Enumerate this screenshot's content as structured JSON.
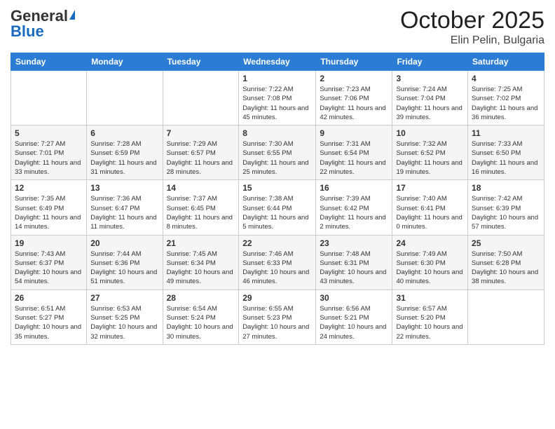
{
  "header": {
    "logo_general": "General",
    "logo_blue": "Blue",
    "month_title": "October 2025",
    "subtitle": "Elin Pelin, Bulgaria"
  },
  "weekdays": [
    "Sunday",
    "Monday",
    "Tuesday",
    "Wednesday",
    "Thursday",
    "Friday",
    "Saturday"
  ],
  "weeks": [
    [
      {
        "day": "",
        "info": ""
      },
      {
        "day": "",
        "info": ""
      },
      {
        "day": "",
        "info": ""
      },
      {
        "day": "1",
        "info": "Sunrise: 7:22 AM\nSunset: 7:08 PM\nDaylight: 11 hours and 45 minutes."
      },
      {
        "day": "2",
        "info": "Sunrise: 7:23 AM\nSunset: 7:06 PM\nDaylight: 11 hours and 42 minutes."
      },
      {
        "day": "3",
        "info": "Sunrise: 7:24 AM\nSunset: 7:04 PM\nDaylight: 11 hours and 39 minutes."
      },
      {
        "day": "4",
        "info": "Sunrise: 7:25 AM\nSunset: 7:02 PM\nDaylight: 11 hours and 36 minutes."
      }
    ],
    [
      {
        "day": "5",
        "info": "Sunrise: 7:27 AM\nSunset: 7:01 PM\nDaylight: 11 hours and 33 minutes."
      },
      {
        "day": "6",
        "info": "Sunrise: 7:28 AM\nSunset: 6:59 PM\nDaylight: 11 hours and 31 minutes."
      },
      {
        "day": "7",
        "info": "Sunrise: 7:29 AM\nSunset: 6:57 PM\nDaylight: 11 hours and 28 minutes."
      },
      {
        "day": "8",
        "info": "Sunrise: 7:30 AM\nSunset: 6:55 PM\nDaylight: 11 hours and 25 minutes."
      },
      {
        "day": "9",
        "info": "Sunrise: 7:31 AM\nSunset: 6:54 PM\nDaylight: 11 hours and 22 minutes."
      },
      {
        "day": "10",
        "info": "Sunrise: 7:32 AM\nSunset: 6:52 PM\nDaylight: 11 hours and 19 minutes."
      },
      {
        "day": "11",
        "info": "Sunrise: 7:33 AM\nSunset: 6:50 PM\nDaylight: 11 hours and 16 minutes."
      }
    ],
    [
      {
        "day": "12",
        "info": "Sunrise: 7:35 AM\nSunset: 6:49 PM\nDaylight: 11 hours and 14 minutes."
      },
      {
        "day": "13",
        "info": "Sunrise: 7:36 AM\nSunset: 6:47 PM\nDaylight: 11 hours and 11 minutes."
      },
      {
        "day": "14",
        "info": "Sunrise: 7:37 AM\nSunset: 6:45 PM\nDaylight: 11 hours and 8 minutes."
      },
      {
        "day": "15",
        "info": "Sunrise: 7:38 AM\nSunset: 6:44 PM\nDaylight: 11 hours and 5 minutes."
      },
      {
        "day": "16",
        "info": "Sunrise: 7:39 AM\nSunset: 6:42 PM\nDaylight: 11 hours and 2 minutes."
      },
      {
        "day": "17",
        "info": "Sunrise: 7:40 AM\nSunset: 6:41 PM\nDaylight: 11 hours and 0 minutes."
      },
      {
        "day": "18",
        "info": "Sunrise: 7:42 AM\nSunset: 6:39 PM\nDaylight: 10 hours and 57 minutes."
      }
    ],
    [
      {
        "day": "19",
        "info": "Sunrise: 7:43 AM\nSunset: 6:37 PM\nDaylight: 10 hours and 54 minutes."
      },
      {
        "day": "20",
        "info": "Sunrise: 7:44 AM\nSunset: 6:36 PM\nDaylight: 10 hours and 51 minutes."
      },
      {
        "day": "21",
        "info": "Sunrise: 7:45 AM\nSunset: 6:34 PM\nDaylight: 10 hours and 49 minutes."
      },
      {
        "day": "22",
        "info": "Sunrise: 7:46 AM\nSunset: 6:33 PM\nDaylight: 10 hours and 46 minutes."
      },
      {
        "day": "23",
        "info": "Sunrise: 7:48 AM\nSunset: 6:31 PM\nDaylight: 10 hours and 43 minutes."
      },
      {
        "day": "24",
        "info": "Sunrise: 7:49 AM\nSunset: 6:30 PM\nDaylight: 10 hours and 40 minutes."
      },
      {
        "day": "25",
        "info": "Sunrise: 7:50 AM\nSunset: 6:28 PM\nDaylight: 10 hours and 38 minutes."
      }
    ],
    [
      {
        "day": "26",
        "info": "Sunrise: 6:51 AM\nSunset: 5:27 PM\nDaylight: 10 hours and 35 minutes."
      },
      {
        "day": "27",
        "info": "Sunrise: 6:53 AM\nSunset: 5:25 PM\nDaylight: 10 hours and 32 minutes."
      },
      {
        "day": "28",
        "info": "Sunrise: 6:54 AM\nSunset: 5:24 PM\nDaylight: 10 hours and 30 minutes."
      },
      {
        "day": "29",
        "info": "Sunrise: 6:55 AM\nSunset: 5:23 PM\nDaylight: 10 hours and 27 minutes."
      },
      {
        "day": "30",
        "info": "Sunrise: 6:56 AM\nSunset: 5:21 PM\nDaylight: 10 hours and 24 minutes."
      },
      {
        "day": "31",
        "info": "Sunrise: 6:57 AM\nSunset: 5:20 PM\nDaylight: 10 hours and 22 minutes."
      },
      {
        "day": "",
        "info": ""
      }
    ]
  ]
}
